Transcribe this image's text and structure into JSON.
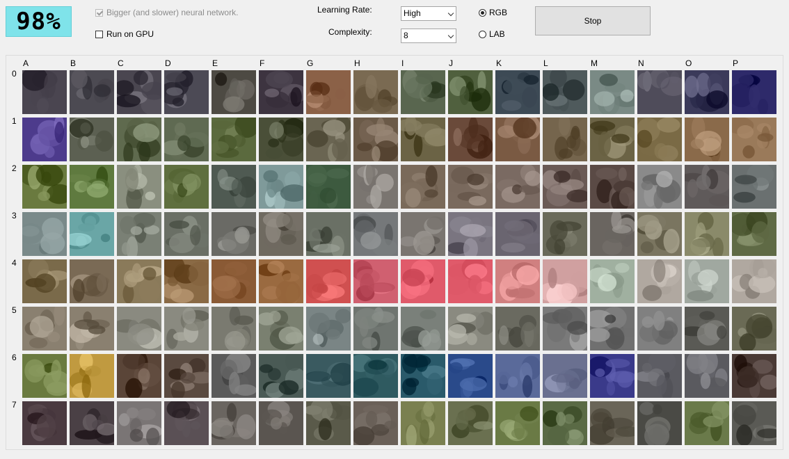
{
  "progress": {
    "value": "98%"
  },
  "options": {
    "bigger_network": {
      "label": "Bigger (and slower) neural network.",
      "checked": true,
      "enabled": false
    },
    "run_on_gpu": {
      "label": "Run on GPU",
      "checked": false
    }
  },
  "learning_rate": {
    "label": "Learning Rate:",
    "value": "High"
  },
  "complexity": {
    "label": "Complexity:",
    "value": "8"
  },
  "color_space": {
    "options": [
      "RGB",
      "LAB"
    ],
    "selected": "RGB"
  },
  "stop_button": {
    "label": "Stop"
  },
  "grid": {
    "columns": [
      "A",
      "B",
      "C",
      "D",
      "E",
      "F",
      "G",
      "H",
      "I",
      "J",
      "K",
      "L",
      "M",
      "N",
      "O",
      "P"
    ],
    "rows": [
      "0",
      "1",
      "2",
      "3",
      "4",
      "5",
      "6",
      "7"
    ],
    "row_colors": [
      [
        "#4a4550",
        "#4c4a52",
        "#4a4650",
        "#4c4a55",
        "#4d4a43",
        "#3d3440",
        "#8b6147",
        "#7a6a52",
        "#59664f",
        "#50603e",
        "#3d4a55",
        "#4f5a5c",
        "#7a8a85",
        "#4f4c5a",
        "#3b3a5a",
        "#2e2a6a"
      ],
      [
        "#4d3b8c",
        "#5c6052",
        "#5f6a4e",
        "#5f6a52",
        "#5b6a3e",
        "#4a4f38",
        "#6a6552",
        "#6b5a48",
        "#6b6345",
        "#6a4a3a",
        "#7a5a43",
        "#75654d",
        "#6b6345",
        "#7a6a45",
        "#8a6a4a",
        "#9a7a5a"
      ],
      [
        "#6a7a3f",
        "#5f7a3f",
        "#8a8f7f",
        "#5f6f3f",
        "#4f5a52",
        "#7f9a9a",
        "#3d5a3f",
        "#7a7570",
        "#7a6a5a",
        "#7a6a5e",
        "#7a6a62",
        "#6a5a55",
        "#5a4a45",
        "#8a8a8a",
        "#5f5a5a",
        "#6a7070"
      ],
      [
        "#7a8a8a",
        "#6aa6a6",
        "#7a8075",
        "#6a6f65",
        "#6a6a65",
        "#6f6a60",
        "#6a7065",
        "#75787a",
        "#7a7570",
        "#7a7580",
        "#6a6570",
        "#6a6a5a",
        "#6a6560",
        "#7a7560",
        "#8a8a6a",
        "#5f6a45"
      ],
      [
        "#7a6a4a",
        "#7a6a55",
        "#8a7a5a",
        "#8a6a45",
        "#8a5a35",
        "#9a6a40",
        "#d05050",
        "#d06070",
        "#e05a6a",
        "#e05a6a",
        "#d08080",
        "#d0a0a0",
        "#a0b0a0",
        "#b0a8a0",
        "#a0a8a0",
        "#b0a8a0"
      ],
      [
        "#8a8070",
        "#8a8070",
        "#8a8a80",
        "#8a8a80",
        "#7a7a70",
        "#7a8070",
        "#7a8585",
        "#6f7570",
        "#7a807a",
        "#8a8a80",
        "#6a6a60",
        "#7a7a7a",
        "#707070",
        "#808080",
        "#5a5a55",
        "#6a6a55"
      ],
      [
        "#6a7a3f",
        "#c09a40",
        "#5a4538",
        "#5a4a40",
        "#5a5a5a",
        "#4a5a55",
        "#3a5a60",
        "#2f5a60",
        "#2a5a6a",
        "#2a4a8a",
        "#5a6a9a",
        "#6a7090",
        "#3a3a8a",
        "#5a5a60",
        "#5a5a5f",
        "#4a3a35"
      ],
      [
        "#4a3a40",
        "#4a4045",
        "#7a7575",
        "#5a5055",
        "#6a6560",
        "#5a5550",
        "#5a5a4a",
        "#6a6058",
        "#7a8050",
        "#6a7050",
        "#6a7a45",
        "#5a6a45",
        "#6a6558",
        "#4a4a45",
        "#6a7a4a",
        "#5a5a55"
      ]
    ]
  }
}
